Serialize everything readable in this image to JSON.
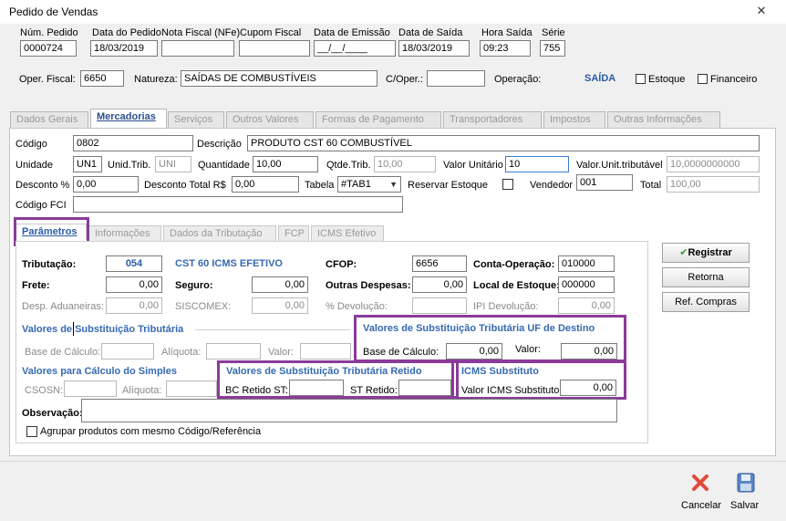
{
  "window": {
    "title": "Pedido de Vendas"
  },
  "header": {
    "num_pedido": {
      "label": "Núm. Pedido",
      "value": "0000724"
    },
    "data_pedido": {
      "label": "Data do Pedido",
      "value": "18/03/2019"
    },
    "nota_fiscal": {
      "label": "Nota Fiscal (NFe)",
      "value": ""
    },
    "cupom_fiscal": {
      "label": "Cupom Fiscal",
      "value": ""
    },
    "data_emissao": {
      "label": "Data de Emissão",
      "value": "__/__/____"
    },
    "data_saida": {
      "label": "Data de Saída",
      "value": "18/03/2019"
    },
    "hora_saida": {
      "label": "Hora Saída",
      "value": "09:23"
    },
    "serie": {
      "label": "Série",
      "value": "755"
    },
    "oper_fiscal": {
      "label": "Oper. Fiscal:",
      "value": "6650"
    },
    "natureza": {
      "label": "Natureza:",
      "value": "SAÍDAS DE COMBUSTÍVEIS"
    },
    "c_oper": {
      "label": "C/Oper.:",
      "value": ""
    },
    "operacao": {
      "label": "Operação:",
      "value": "SAÍDA"
    },
    "estoque": {
      "label": "Estoque"
    },
    "financeiro": {
      "label": "Financeiro"
    }
  },
  "tabs": [
    "Dados Gerais",
    "Mercadorias",
    "Serviços",
    "Outros Valores",
    "Formas de Pagamento",
    "Transportadores",
    "Impostos",
    "Outras Informações"
  ],
  "produto": {
    "codigo": {
      "label": "Código",
      "value": "0802"
    },
    "descricao": {
      "label": "Descrição",
      "value": "PRODUTO CST 60 COMBUSTÍVEL"
    },
    "unidade": {
      "label": "Unidade",
      "value": "UN1"
    },
    "unid_trib": {
      "label": "Unid.Trib.",
      "value": "UNI"
    },
    "quantidade": {
      "label": "Quantidade",
      "value": "10,00"
    },
    "qtde_trib": {
      "label": "Qtde.Trib.",
      "value": "10,00"
    },
    "valor_unitario": {
      "label": "Valor Unitário",
      "value": "10"
    },
    "valor_unit_trib": {
      "label": "Valor.Unit.tributável",
      "value": "10,0000000000"
    },
    "desconto_pct": {
      "label": "Desconto %",
      "value": "0,00"
    },
    "desconto_total": {
      "label": "Desconto Total R$",
      "value": "0,00"
    },
    "tabela": {
      "label": "Tabela",
      "value": "#TAB1"
    },
    "reservar_estoque": {
      "label": "Reservar Estoque"
    },
    "vendedor": {
      "label": "Vendedor",
      "value": "001"
    },
    "total": {
      "label": "Total",
      "value": "100,00"
    },
    "codigo_fci": {
      "label": "Código FCI",
      "value": ""
    }
  },
  "subtabs": [
    "Parâmetros",
    "Informações",
    "Dados da Tributação",
    "FCP",
    "ICMS Efetivo"
  ],
  "parametros": {
    "tributacao": {
      "label": "Tributação:",
      "value": "054"
    },
    "cst_label": "CST 60 ICMS EFETIVO",
    "cfop": {
      "label": "CFOP:",
      "value": "6656"
    },
    "conta_operacao": {
      "label": "Conta-Operação:",
      "value": "010000"
    },
    "frete": {
      "label": "Frete:",
      "value": "0,00"
    },
    "seguro": {
      "label": "Seguro:",
      "value": "0,00"
    },
    "outras_despesas": {
      "label": "Outras Despesas:",
      "value": "0,00"
    },
    "local_estoque": {
      "label": "Local de Estoque:",
      "value": "000000"
    },
    "desp_aduaneiras": {
      "label": "Desp. Aduaneiras:",
      "value": "0,00"
    },
    "siscomex": {
      "label": "SISCOMEX:",
      "value": "0,00"
    },
    "pct_devolucao": {
      "label": "% Devolução:",
      "value": ""
    },
    "ipi_devolucao": {
      "label": "IPI Devolução:",
      "value": "0,00"
    }
  },
  "st": {
    "title": "Valores de Substituição Tributária",
    "base_calculo": "Base de Cálculo:",
    "aliquota": "Alíquota:",
    "valor": "Valor:"
  },
  "st_uf": {
    "title": "Valores de Substituição Tributária UF de Destino",
    "base_calculo": {
      "label": "Base de Cálculo:",
      "value": "0,00"
    },
    "valor": {
      "label": "Valor:",
      "value": "0,00"
    }
  },
  "simples": {
    "title": "Valores para Cálculo do Simples",
    "csosn": "CSOSN:",
    "aliquota": "Alíquota:"
  },
  "st_retido": {
    "title": "Valores de Substituição Tributária Retido",
    "bc_retido": {
      "label": "BC Retido ST:",
      "value": ""
    },
    "st_retido": {
      "label": "ST Retido:",
      "value": ""
    }
  },
  "icms_substituto": {
    "title": "ICMS Substituto",
    "valor": {
      "label": "Valor ICMS Substituto:",
      "value": "0,00"
    }
  },
  "observacao": {
    "label": "Observação:",
    "value": ""
  },
  "agrupar": {
    "label": "Agrupar produtos com mesmo Código/Referência"
  },
  "buttons": {
    "registrar": "Registrar",
    "retorna": "Retorna",
    "ref_compras": "Ref. Compras"
  },
  "footer": {
    "cancelar": "Cancelar",
    "salvar": "Salvar"
  },
  "colors": {
    "highlight": "#8a3b9a",
    "accent_blue": "#2a5ca8",
    "cancel_red": "#e04a3b"
  }
}
